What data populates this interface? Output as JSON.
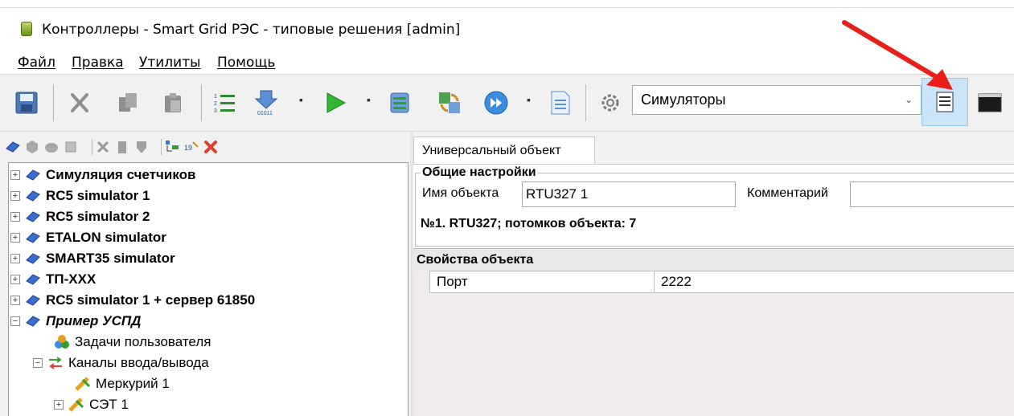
{
  "window": {
    "title": "Контроллеры - Smart Grid РЭС - типовые решения [admin]"
  },
  "menu": {
    "items": [
      "Файл",
      "Правка",
      "Утилиты",
      "Помощь"
    ]
  },
  "toolbar": {
    "buttons": [
      "save-icon",
      "cut-icon",
      "copy-icon",
      "paste-icon",
      "numbered-list-icon",
      "download-binary-icon",
      "play-icon",
      "database-icon",
      "sync-icon",
      "forward-icon",
      "document-icon",
      "settings-icon",
      "log-icon",
      "console-icon"
    ],
    "simulator_select": {
      "value": "Симуляторы"
    }
  },
  "tree": {
    "items": [
      {
        "label": "Симуляция счетчиков",
        "expander": "+"
      },
      {
        "label": "RC5 simulator 1",
        "expander": "+"
      },
      {
        "label": "RC5 simulator 2",
        "expander": "+"
      },
      {
        "label": "ETALON simulator",
        "expander": "+"
      },
      {
        "label": "SMART35 simulator",
        "expander": "+"
      },
      {
        "label": "ТП-XXX",
        "expander": "+"
      },
      {
        "label": "RC5 simulator 1 + сервер 61850",
        "expander": "+"
      },
      {
        "label": "Пример УСПД",
        "expander": "−"
      },
      {
        "label": "Задачи пользователя",
        "expander": ""
      },
      {
        "label": "Каналы ввода/вывода",
        "expander": "−"
      },
      {
        "label": "Меркурий 1",
        "expander": ""
      },
      {
        "label": "СЭТ 1",
        "expander": "+"
      }
    ]
  },
  "tab": {
    "label": "Универсальный объект"
  },
  "general": {
    "legend": "Общие настройки",
    "name_label": "Имя объекта",
    "name_value": "RTU327 1",
    "comment_label": "Комментарий",
    "comment_value": "",
    "summary": "№1. RTU327; потомков объекта: 7"
  },
  "properties": {
    "header": "Свойства объекта",
    "rows": [
      {
        "name": "Порт",
        "value": "2222"
      }
    ]
  },
  "colors": {
    "accent_arrow": "#e8201a",
    "selected_button_bg": "#cce4f7"
  }
}
